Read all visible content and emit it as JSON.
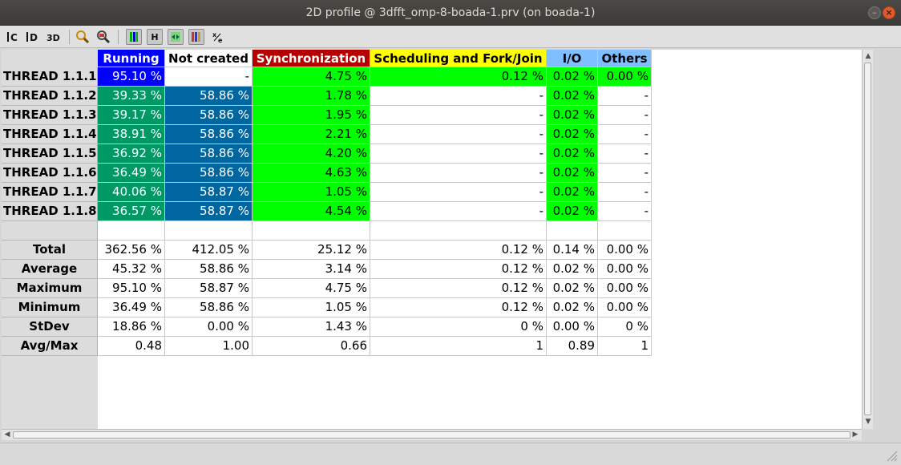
{
  "window": {
    "title": "2D profile @ 3dfft_omp-8-boada-1.prv (on boada-1)",
    "minimize_glyph": "–",
    "close_glyph": "×"
  },
  "toolbar": {
    "buttons": [
      {
        "name": "code-color-icon",
        "glyph": "C",
        "pressed": false
      },
      {
        "name": "data-icon",
        "glyph": "D",
        "pressed": false
      },
      {
        "name": "3d-icon",
        "glyph": "3D",
        "pressed": false
      },
      {
        "name": "zoom-icon",
        "glyph": "",
        "pressed": false
      },
      {
        "name": "open-control-icon",
        "glyph": "",
        "pressed": false
      },
      {
        "name": "color-mode-icon",
        "glyph": "",
        "pressed": true
      },
      {
        "name": "horizontal-icon",
        "glyph": "H",
        "pressed": true
      },
      {
        "name": "hide-empty-icon",
        "glyph": "",
        "pressed": true
      },
      {
        "name": "sort-columns-icon",
        "glyph": "",
        "pressed": true
      },
      {
        "name": "fraction-icon",
        "glyph": "x/e",
        "pressed": false
      }
    ]
  },
  "table": {
    "columns": [
      {
        "label": "Running",
        "bg": "#0000ff",
        "fg": "#ffffff"
      },
      {
        "label": "Not created",
        "bg": "#ffffff",
        "fg": "#000000"
      },
      {
        "label": "Synchronization",
        "bg": "#b40000",
        "fg": "#ffffff"
      },
      {
        "label": "Scheduling and Fork/Join",
        "bg": "#ffff00",
        "fg": "#000000"
      },
      {
        "label": "I/O",
        "bg": "#7fbfff",
        "fg": "#000000"
      },
      {
        "label": "Others",
        "bg": "#7fbfff",
        "fg": "#000000"
      }
    ],
    "threads": [
      {
        "label": "THREAD 1.1.1",
        "values": [
          "95.10 %",
          "-",
          "4.75 %",
          "0.12 %",
          "0.02 %",
          "0.00 %"
        ],
        "bgs": [
          "#0000ff",
          "#ffffff",
          "#00ff00",
          "#00ff00",
          "#00ff00",
          "#00ff00"
        ],
        "fgs": [
          "#ffffff",
          "#000000",
          "#000000",
          "#000000",
          "#000000",
          "#000000"
        ]
      },
      {
        "label": "THREAD 1.1.2",
        "values": [
          "39.33 %",
          "58.86 %",
          "1.78 %",
          "-",
          "0.02 %",
          "-"
        ],
        "bgs": [
          "#009966",
          "#0066a0",
          "#00ff00",
          "#ffffff",
          "#00ff00",
          "#ffffff"
        ],
        "fgs": [
          "#ffffff",
          "#ffffff",
          "#000000",
          "#000000",
          "#000000",
          "#000000"
        ]
      },
      {
        "label": "THREAD 1.1.3",
        "values": [
          "39.17 %",
          "58.86 %",
          "1.95 %",
          "-",
          "0.02 %",
          "-"
        ],
        "bgs": [
          "#009966",
          "#0066a0",
          "#00ff00",
          "#ffffff",
          "#00ff00",
          "#ffffff"
        ],
        "fgs": [
          "#ffffff",
          "#ffffff",
          "#000000",
          "#000000",
          "#000000",
          "#000000"
        ]
      },
      {
        "label": "THREAD 1.1.4",
        "values": [
          "38.91 %",
          "58.86 %",
          "2.21 %",
          "-",
          "0.02 %",
          "-"
        ],
        "bgs": [
          "#009966",
          "#0066a0",
          "#00ff00",
          "#ffffff",
          "#00ff00",
          "#ffffff"
        ],
        "fgs": [
          "#ffffff",
          "#ffffff",
          "#000000",
          "#000000",
          "#000000",
          "#000000"
        ]
      },
      {
        "label": "THREAD 1.1.5",
        "values": [
          "36.92 %",
          "58.86 %",
          "4.20 %",
          "-",
          "0.02 %",
          "-"
        ],
        "bgs": [
          "#009966",
          "#0066a0",
          "#00ff00",
          "#ffffff",
          "#00ff00",
          "#ffffff"
        ],
        "fgs": [
          "#ffffff",
          "#ffffff",
          "#000000",
          "#000000",
          "#000000",
          "#000000"
        ]
      },
      {
        "label": "THREAD 1.1.6",
        "values": [
          "36.49 %",
          "58.86 %",
          "4.63 %",
          "-",
          "0.02 %",
          "-"
        ],
        "bgs": [
          "#009966",
          "#0066a0",
          "#00ff00",
          "#ffffff",
          "#00ff00",
          "#ffffff"
        ],
        "fgs": [
          "#ffffff",
          "#ffffff",
          "#000000",
          "#000000",
          "#000000",
          "#000000"
        ]
      },
      {
        "label": "THREAD 1.1.7",
        "values": [
          "40.06 %",
          "58.87 %",
          "1.05 %",
          "-",
          "0.02 %",
          "-"
        ],
        "bgs": [
          "#009966",
          "#0066a0",
          "#00ff00",
          "#ffffff",
          "#00ff00",
          "#ffffff"
        ],
        "fgs": [
          "#ffffff",
          "#ffffff",
          "#000000",
          "#000000",
          "#000000",
          "#000000"
        ]
      },
      {
        "label": "THREAD 1.1.8",
        "values": [
          "36.57 %",
          "58.87 %",
          "4.54 %",
          "-",
          "0.02 %",
          "-"
        ],
        "bgs": [
          "#009966",
          "#0066a0",
          "#00ff00",
          "#ffffff",
          "#00ff00",
          "#ffffff"
        ],
        "fgs": [
          "#ffffff",
          "#ffffff",
          "#000000",
          "#000000",
          "#000000",
          "#000000"
        ]
      }
    ],
    "stats": [
      {
        "label": "Total",
        "values": [
          "362.56 %",
          "412.05 %",
          "25.12 %",
          "0.12 %",
          "0.14 %",
          "0.00 %"
        ]
      },
      {
        "label": "Average",
        "values": [
          "45.32 %",
          "58.86 %",
          "3.14 %",
          "0.12 %",
          "0.02 %",
          "0.00 %"
        ]
      },
      {
        "label": "Maximum",
        "values": [
          "95.10 %",
          "58.87 %",
          "4.75 %",
          "0.12 %",
          "0.02 %",
          "0.00 %"
        ]
      },
      {
        "label": "Minimum",
        "values": [
          "36.49 %",
          "58.86 %",
          "1.05 %",
          "0.12 %",
          "0.02 %",
          "0.00 %"
        ]
      },
      {
        "label": "StDev",
        "values": [
          "18.86 %",
          "0.00 %",
          "1.43 %",
          "0 %",
          "0.00 %",
          "0 %"
        ]
      },
      {
        "label": "Avg/Max",
        "values": [
          "0.48",
          "1.00",
          "0.66",
          "1",
          "0.89",
          "1"
        ]
      }
    ]
  },
  "scrollbars": {
    "up_arrow": "▲",
    "down_arrow": "▼",
    "left_arrow": "◀",
    "right_arrow": "▶"
  }
}
